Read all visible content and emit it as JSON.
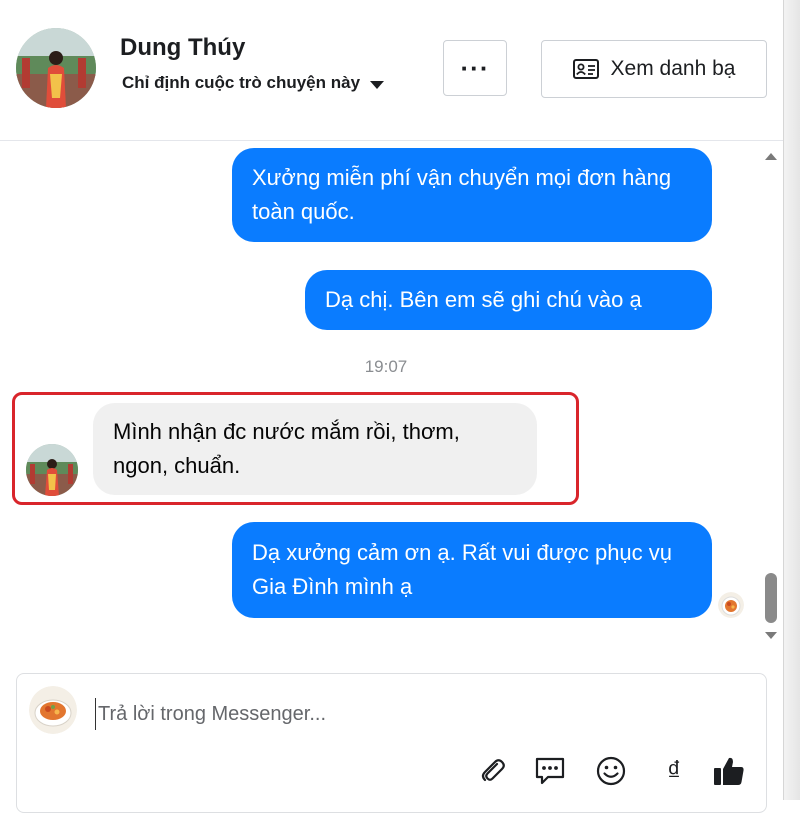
{
  "header": {
    "contact_name": "Dung Thúy",
    "assign_label": "Chỉ định cuộc trò chuyện này",
    "more_label": "···",
    "view_contacts_label": "Xem danh bạ"
  },
  "messages": [
    {
      "direction": "outgoing",
      "text": "Xưởng miễn phí vận chuyển mọi đơn hàng toàn quốc."
    },
    {
      "direction": "outgoing",
      "text": "Dạ chị. Bên em sẽ ghi chú vào ạ"
    },
    {
      "direction": "incoming",
      "text": "Mình nhận đc nước mắm rồi, thơm, ngon, chuẩn."
    },
    {
      "direction": "outgoing",
      "text": "Dạ xưởng cảm ơn ạ. Rất vui được phục vụ Gia Đình mình ạ"
    }
  ],
  "timestamp": "19:07",
  "composer": {
    "placeholder": "Trả lời trong Messenger...",
    "value": "",
    "currency_symbol": "₫"
  },
  "icons": [
    "more-icon",
    "contact-card-icon",
    "caret-down-icon",
    "attach-icon",
    "saved-reply-icon",
    "emoji-icon",
    "currency-icon",
    "like-icon"
  ],
  "colors": {
    "outgoing_bubble": "#0a7cff",
    "incoming_bubble": "#f0f0f0",
    "highlight_border": "#d9252b"
  }
}
